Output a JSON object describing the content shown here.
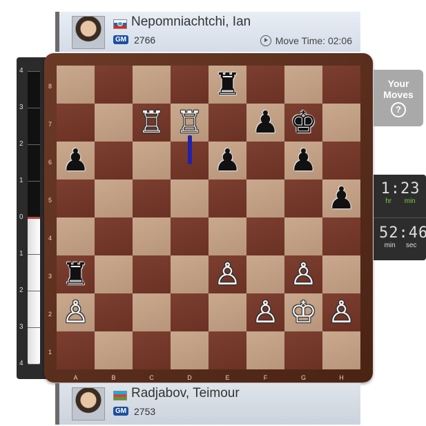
{
  "top_player": {
    "name": "Nepomniachtchi, Ian",
    "title": "GM",
    "rating": "2766",
    "move_time_label": "Move Time: 02:06",
    "flag": "russia-flag-icon"
  },
  "bottom_player": {
    "name": "Radjabov, Teimour",
    "title": "GM",
    "rating": "2753",
    "flag": "azerbaijan-flag-icon"
  },
  "eval_bar": {
    "labels_top": [
      "4",
      "3",
      "2",
      "1",
      "0"
    ],
    "labels_bottom": [
      "1",
      "2",
      "3",
      "4"
    ],
    "white_fraction": 0.5
  },
  "your_moves": {
    "line1": "Your",
    "line2": "Moves",
    "help": "?"
  },
  "clock": {
    "main_digits": "1:23",
    "main_unit_a": "hr",
    "main_unit_b": "min",
    "second_digits": "52:46",
    "second_unit_a": "min",
    "second_unit_b": "sec"
  },
  "board": {
    "files": [
      "A",
      "B",
      "C",
      "D",
      "E",
      "F",
      "G",
      "H"
    ],
    "ranks": [
      "8",
      "7",
      "6",
      "5",
      "4",
      "3",
      "2",
      "1"
    ],
    "position": [
      [
        "",
        "",
        "",
        "",
        "bR",
        "",
        "",
        ""
      ],
      [
        "",
        "",
        "wR",
        "wR",
        "",
        "bP",
        "bK",
        ""
      ],
      [
        "bP",
        "",
        "",
        "",
        "bP",
        "",
        "bP",
        ""
      ],
      [
        "",
        "",
        "",
        "",
        "",
        "",
        "",
        "bP"
      ],
      [
        "",
        "",
        "",
        "",
        "",
        "",
        "",
        ""
      ],
      [
        "bR",
        "",
        "",
        "",
        "wP",
        "",
        "wP",
        ""
      ],
      [
        "wP",
        "",
        "",
        "",
        "",
        "wP",
        "wK",
        "wP"
      ],
      [
        "",
        "",
        "",
        "",
        "",
        "",
        "",
        ""
      ]
    ]
  },
  "colors": {
    "light_square": "#c9a98e",
    "dark_square": "#7c3f30",
    "frame": "#5a2c1c",
    "clock_accent": "#7cc943",
    "eval_zero": "#e03030",
    "move_marker": "#2222aa"
  }
}
